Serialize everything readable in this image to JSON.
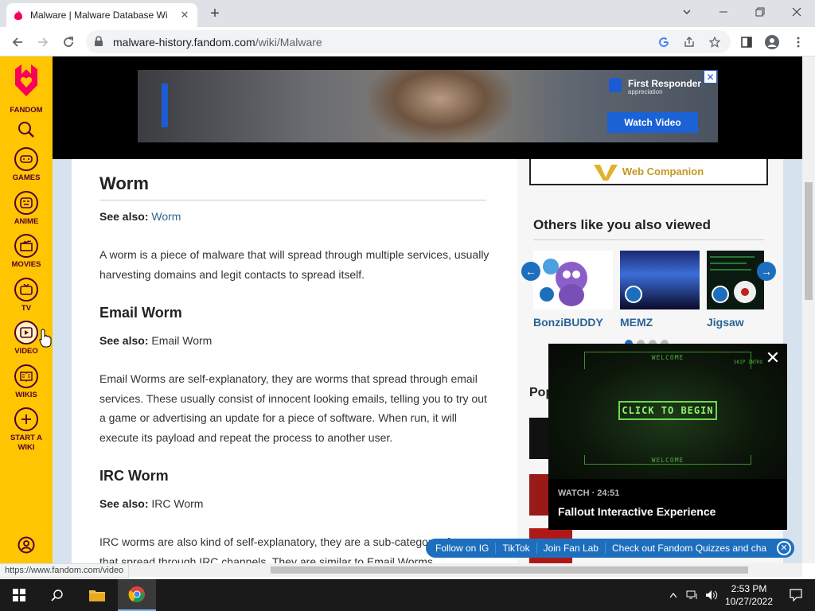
{
  "browser": {
    "tab_title": "Malware | Malware Database Wi",
    "url_domain": "malware-history.fandom.com",
    "url_path": "/wiki/Malware",
    "status_url": "https://www.fandom.com/video"
  },
  "rail": {
    "logo_label": "FANDOM",
    "items": [
      {
        "label": "GAMES",
        "icon": "gamepad-icon"
      },
      {
        "label": "ANIME",
        "icon": "anime-icon"
      },
      {
        "label": "MOVIES",
        "icon": "clapper-icon"
      },
      {
        "label": "TV",
        "icon": "tv-icon"
      },
      {
        "label": "VIDEO",
        "icon": "play-icon"
      },
      {
        "label": "WIKIS",
        "icon": "book-icon"
      },
      {
        "label": "START A WIKI",
        "icon": "plus-icon"
      }
    ]
  },
  "ad": {
    "title": "First Responder",
    "subtitle": "appreciation",
    "button": "Watch Video"
  },
  "article": {
    "h_worm": "Worm",
    "seealso_label": "See also:",
    "worm_link": "Worm",
    "worm_para": "A worm is a piece of malware that will spread through multiple services, usually harvesting domains and legit contacts to spread itself.",
    "h_email": "Email Worm",
    "email_link": "Email Worm",
    "email_para": "Email Worms are self-explanatory, they are worms that spread through email services. These usually consist of innocent looking emails, telling you to try out a game or advertising an update for a piece of software. When run, it will execute its payload and repeat the process to another user.",
    "h_irc": "IRC Worm",
    "irc_link": "IRC Worm",
    "irc_para": "IRC worms are also kind of self-explanatory, they are a sub-category of worms that spread through IRC channels. They are similar to Email Worms"
  },
  "sidebar": {
    "web_companion": "Web Companion",
    "others_title": "Others like you also viewed",
    "cards": [
      "BonziBUDDY",
      "MEMZ",
      "Jigsaw"
    ],
    "popular_title": "Pop"
  },
  "video": {
    "welcome": "WELCOME",
    "skip": "SKIP INTRO",
    "click": "CLICK TO BEGIN",
    "watch": "WATCH · 24:51",
    "title": "Fallout Interactive Experience"
  },
  "social": [
    "Follow on IG",
    "TikTok",
    "Join Fan Lab",
    "Check out Fandom Quizzes and cha"
  ],
  "taskbar": {
    "time": "2:53 PM",
    "date": "10/27/2022"
  },
  "colors": {
    "fandom_yellow": "#ffc500",
    "fandom_purple": "#520032",
    "link_blue": "#2a6496",
    "accent_blue": "#1d6fbe"
  }
}
